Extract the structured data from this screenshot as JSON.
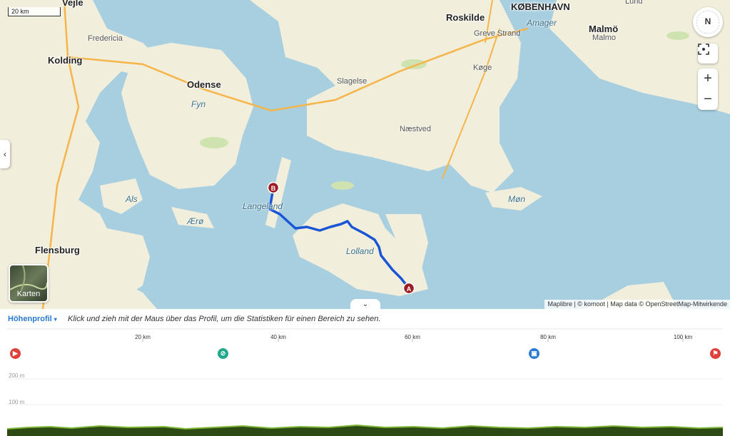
{
  "map": {
    "scale_label": "20 km",
    "attribution": "Maplibre | © komoot | Map data © OpenStreetMap-Mitwirkende",
    "layers_label": "Karten",
    "compass_label": "N",
    "zoom_in": "+",
    "zoom_out": "−",
    "cities": [
      "Vejle",
      "Kolding",
      "Odense",
      "Roskilde",
      "KØBENHAVN",
      "Malmö",
      "Flensburg"
    ],
    "towns": [
      "Fredericia",
      "Slagelse",
      "Greve Strand",
      "Køge",
      "Næstved",
      "Malmo",
      "Lund"
    ],
    "islands": [
      "Fyn",
      "Amager",
      "Als",
      "Ærø",
      "Langeland",
      "Lolland",
      "Møn"
    ],
    "markers": {
      "start": "A",
      "end": "B"
    },
    "colors": {
      "water": "#a8cfe0",
      "land": "#f1eedc",
      "route": "#1a55d6",
      "marker": "#9b1c22"
    }
  },
  "profile": {
    "title": "Höhenprofil",
    "hint": "Klick und zieh mit der Maus über das Profil, um die Statistiken für einen Bereich zu sehen.",
    "x_ticks": [
      "20 km",
      "40 km",
      "60 km",
      "80 km",
      "100 km"
    ],
    "y_labels": [
      "200 m",
      "100 m"
    ],
    "poi_icons": [
      "play-icon",
      "no-entry-icon",
      "train-icon",
      "finish-flag-icon"
    ],
    "colors": {
      "line": "#7bb534",
      "fill": "#2d4a14",
      "title": "#2a7bd0"
    }
  }
}
